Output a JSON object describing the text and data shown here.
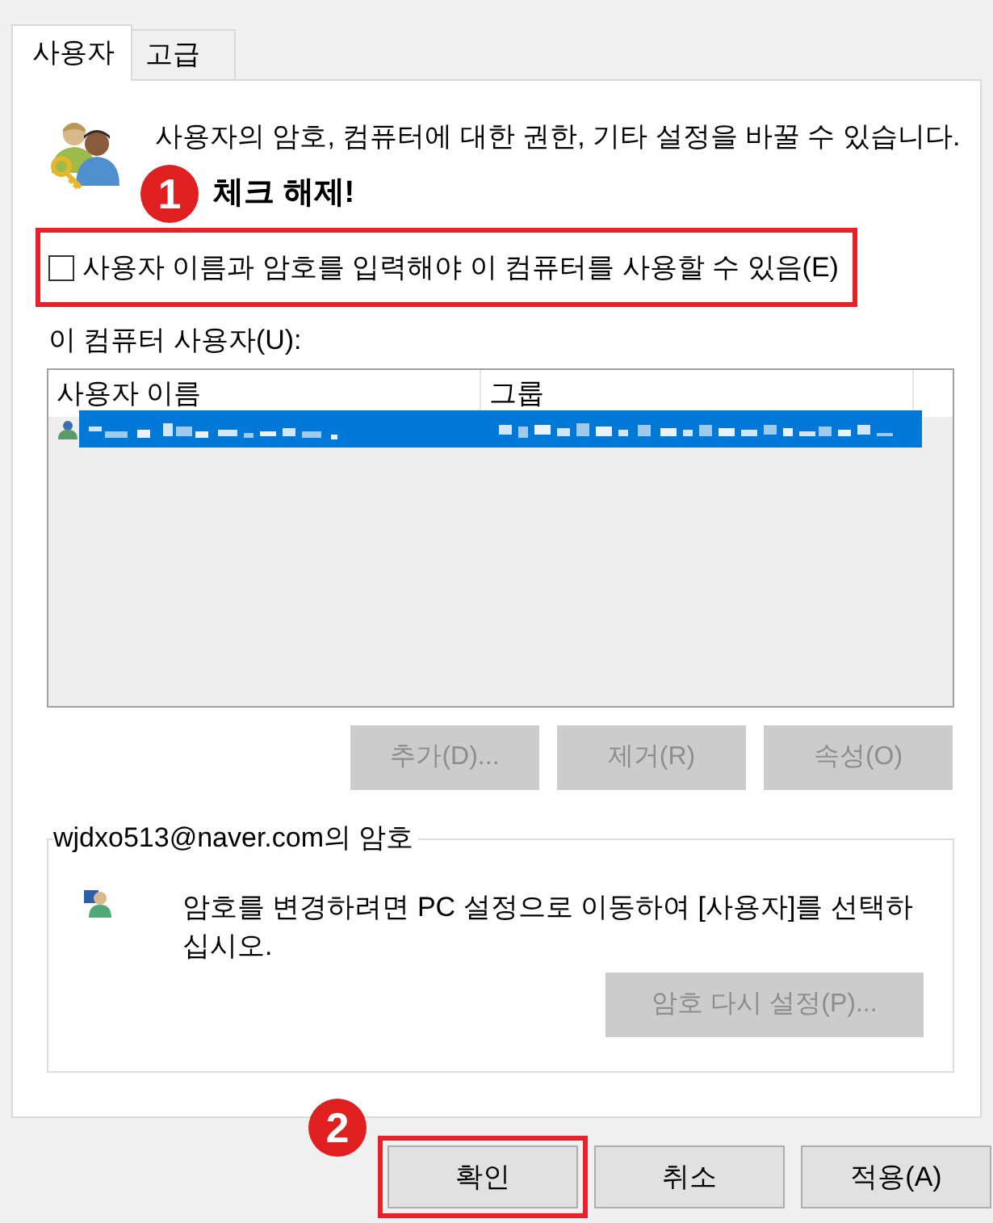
{
  "tabs": [
    {
      "label": "사용자",
      "selected": true
    },
    {
      "label": "고급",
      "selected": false
    }
  ],
  "intro": {
    "text": "사용자의 암호, 컴퓨터에 대한 권한, 기타 설정을 바꿀 수 있습니다."
  },
  "callouts": [
    {
      "number": "1",
      "text": "체크 해제!"
    },
    {
      "number": "2"
    }
  ],
  "require_login": {
    "label": "사용자 이름과 암호를 입력해야 이 컴퓨터를 사용할 수 있음(E)",
    "checked": false,
    "annotated": true
  },
  "users": {
    "label": "이 컴퓨터 사용자(U):",
    "columns": [
      "사용자 이름",
      "그룹"
    ],
    "rows": [
      {
        "selected": true
      }
    ]
  },
  "user_buttons": [
    {
      "label": "추가(D)...",
      "disabled": true
    },
    {
      "label": "제거(R)",
      "disabled": true
    },
    {
      "label": "속성(O)",
      "disabled": true
    }
  ],
  "password_group": {
    "title": "wjdxo513@naver.com의 암호",
    "message": "암호를 변경하려면 PC 설정으로 이동하여 [사용자]를 선택하십시오.",
    "button": {
      "label": "암호 다시 설정(P)...",
      "disabled": true
    }
  },
  "dialog_buttons": [
    {
      "label": "확인",
      "annotated": true
    },
    {
      "label": "취소",
      "annotated": false
    },
    {
      "label": "적용(A)",
      "annotated": false
    }
  ]
}
